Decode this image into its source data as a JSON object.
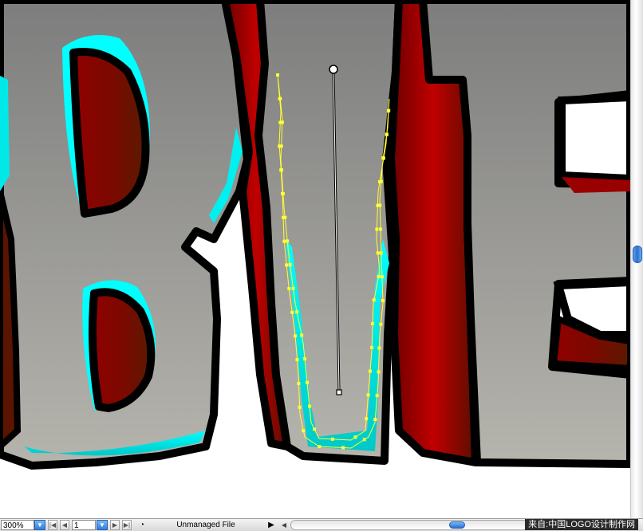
{
  "statusbar": {
    "zoom": "300%",
    "artboard": "1",
    "status_text": "Unmanaged File",
    "watermark": "来自:中国LOGO设计制作网"
  },
  "icons": {
    "zoom_dropdown": "chevron-down-icon",
    "artboard_dropdown": "chevron-down-icon",
    "first": "first-page-icon",
    "prev": "previous-page-icon",
    "next": "next-page-icon",
    "last": "last-page-icon",
    "status_menu": "triangle-right-icon"
  },
  "colors": {
    "background_top": "#7f7f7f",
    "background_bottom": "#b3b2ab",
    "letter_red": "#b80000",
    "letter_grey": "#a9a8a3",
    "outline": "#000000",
    "highlight_cyan": "#00ffff",
    "path_selection": "#ffff33"
  }
}
